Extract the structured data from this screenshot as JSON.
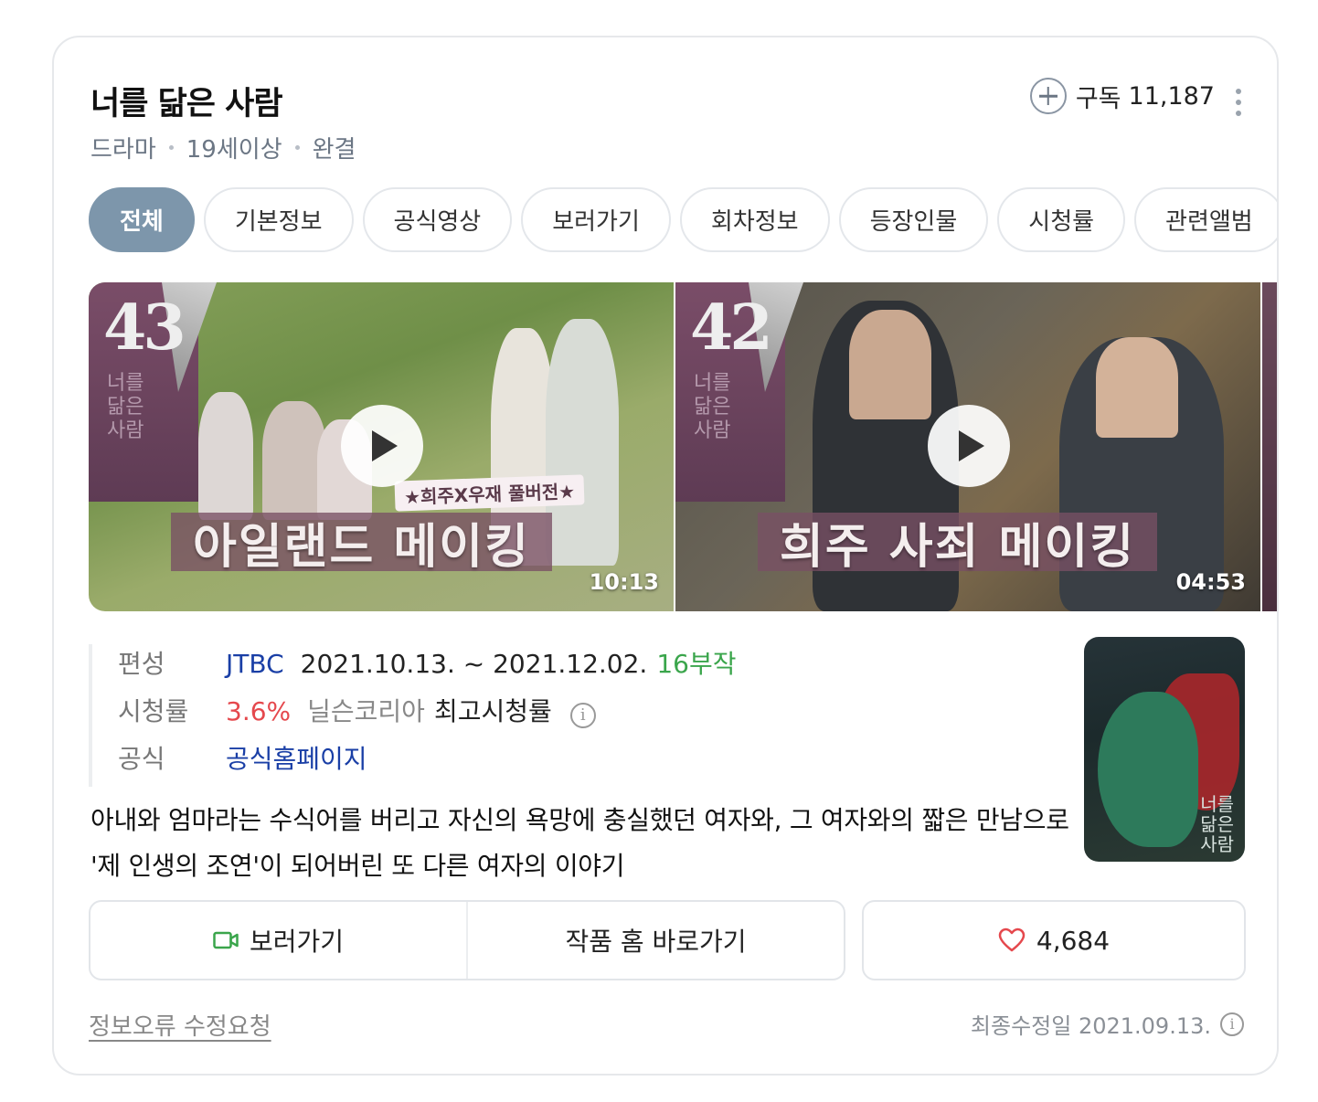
{
  "header": {
    "title": "너를 닮은 사람",
    "meta": [
      "드라마",
      "19세이상",
      "완결"
    ],
    "subscribe_label": "구독",
    "subscribe_count": "11,187"
  },
  "tabs": [
    {
      "label": "전체",
      "active": true
    },
    {
      "label": "기본정보",
      "active": false
    },
    {
      "label": "공식영상",
      "active": false
    },
    {
      "label": "보러가기",
      "active": false
    },
    {
      "label": "회차정보",
      "active": false
    },
    {
      "label": "등장인물",
      "active": false
    },
    {
      "label": "시청률",
      "active": false
    },
    {
      "label": "관련앨범",
      "active": false
    }
  ],
  "videos": [
    {
      "episode": "43",
      "poster_text": "너를 닮은 사람",
      "subtitle": "★희주X우재 풀버전★",
      "banner": "아일랜드 메이킹",
      "duration": "10:13"
    },
    {
      "episode": "42",
      "poster_text": "너를 닮은 사람",
      "banner": "희주 사죄 메이킹",
      "duration": "04:53"
    }
  ],
  "info": {
    "broadcast_label": "편성",
    "channel": "JTBC",
    "period": "2021.10.13. ~ 2021.12.02.",
    "episodes": "16부작",
    "rating_label": "시청률",
    "rating_value": "3.6%",
    "rating_source": "닐슨코리아",
    "rating_desc": "최고시청률",
    "official_label": "공식",
    "official_link": "공식홈페이지"
  },
  "poster": {
    "title": "너를 닮은 사람"
  },
  "description": "아내와 엄마라는 수식어를 버리고 자신의 욕망에 충실했던 여자와, 그 여자와의 짧은 만남으로 '제 인생의 조연'이 되어버린 또 다른 여자의 이야기",
  "actions": {
    "watch_label": "보러가기",
    "home_label": "작품 홈 바로가기",
    "like_count": "4,684"
  },
  "footer": {
    "report_label": "정보오류 수정요청",
    "updated": "최종수정일 2021.09.13."
  },
  "colors": {
    "active_tab": "#7d96ab",
    "channel_link": "#1a3fa6",
    "episodes": "#3aa54b",
    "rating": "#e5484d",
    "heart": "#e5484d",
    "camera": "#3aa54b"
  },
  "icons": [
    "plus-circle-icon",
    "more-vertical-icon",
    "play-icon",
    "info-icon",
    "camera-icon",
    "heart-icon"
  ]
}
